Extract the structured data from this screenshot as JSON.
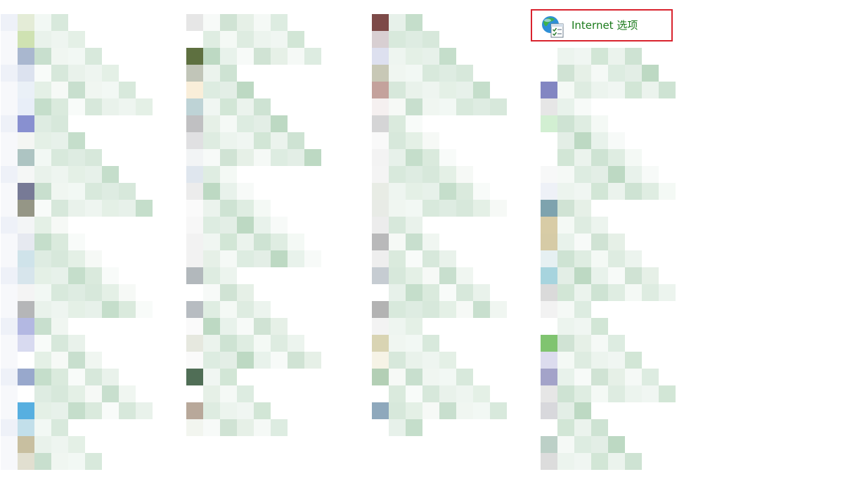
{
  "control_panel": {
    "highlighted_item": {
      "label": "Internet 选项",
      "icon": "internet-options-icon"
    }
  },
  "colors": {
    "highlight_border": "#d9232e",
    "link_text": "#1a7a1a",
    "background": "#ffffff"
  }
}
